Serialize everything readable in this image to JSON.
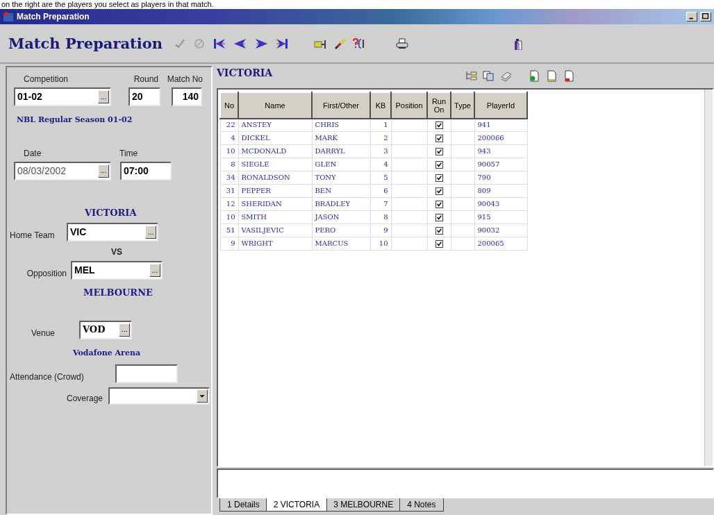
{
  "caption": "on the right are the players you select as players in that match.",
  "window": {
    "title": "Match Preparation"
  },
  "toolbar": {
    "title": "Match Preparation"
  },
  "details": {
    "competition": {
      "label": "Competition",
      "value": "01-02",
      "lookup": "..."
    },
    "round": {
      "label": "Round",
      "value": "20"
    },
    "match_no": {
      "label": "Match No",
      "value": "140"
    },
    "competition_name": "NBL Regular Season 01-02",
    "date": {
      "label": "Date",
      "value": "08/03/2002",
      "lookup": "..."
    },
    "time": {
      "label": "Time",
      "value": "07:00"
    },
    "home_team_name": "VICTORIA",
    "home_team": {
      "label": "Home Team",
      "value": "VIC",
      "lookup": "..."
    },
    "versus": "VS",
    "opposition": {
      "label": "Opposition",
      "value": "MEL",
      "lookup": "..."
    },
    "opposition_name": "MELBOURNE",
    "venue": {
      "label": "Venue",
      "value": "VOD",
      "lookup": "..."
    },
    "venue_name": "Vodafone Arena",
    "attendance": {
      "label": "Attendance (Crowd)"
    },
    "coverage": {
      "label": "Coverage"
    }
  },
  "team_panel": {
    "title": "VICTORIA",
    "columns": [
      "No",
      "Name",
      "First/Other",
      "KB",
      "Position",
      "Run On",
      "Type",
      "PlayerId"
    ],
    "rows": [
      {
        "no": "22",
        "name": "ANSTEY",
        "first": "CHRIS",
        "kb": "1",
        "run_on": true,
        "player_id": "941"
      },
      {
        "no": "4",
        "name": "DICKEL",
        "first": "MARK",
        "kb": "2",
        "run_on": true,
        "player_id": "200066"
      },
      {
        "no": "10",
        "name": "MCDONALD",
        "first": "DARRYL",
        "kb": "3",
        "run_on": true,
        "player_id": "943"
      },
      {
        "no": "8",
        "name": "SIEGLE",
        "first": "GLEN",
        "kb": "4",
        "run_on": true,
        "player_id": "90057"
      },
      {
        "no": "34",
        "name": "RONALDSON",
        "first": "TONY",
        "kb": "5",
        "run_on": true,
        "player_id": "790"
      },
      {
        "no": "31",
        "name": "PEPPER",
        "first": "BEN",
        "kb": "6",
        "run_on": true,
        "player_id": "809"
      },
      {
        "no": "12",
        "name": "SHERIDAN",
        "first": "BRADLEY",
        "kb": "7",
        "run_on": true,
        "player_id": "90043"
      },
      {
        "no": "10",
        "name": "SMITH",
        "first": "JASON",
        "kb": "8",
        "run_on": true,
        "player_id": "915"
      },
      {
        "no": "51",
        "name": "VASILJEVIC",
        "first": "PERO",
        "kb": "9",
        "run_on": true,
        "player_id": "90032"
      },
      {
        "no": "9",
        "name": "WRIGHT",
        "first": "MARCUS",
        "kb": "10",
        "run_on": true,
        "player_id": "200065"
      }
    ]
  },
  "tabs": [
    {
      "label": "1 Details",
      "selected": false
    },
    {
      "label": "2 VICTORIA",
      "selected": true
    },
    {
      "label": "3 MELBOURNE",
      "selected": false
    },
    {
      "label": "4 Notes",
      "selected": false
    }
  ]
}
